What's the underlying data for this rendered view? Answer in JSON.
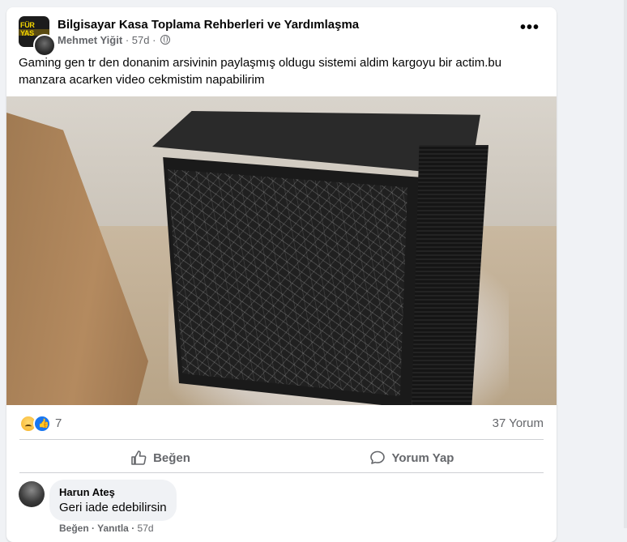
{
  "group": {
    "name": "Bilgisayar Kasa Toplama Rehberleri ve Yardımlaşma",
    "avatar_text": "FÜR YAS"
  },
  "post": {
    "author": "Mehmet Yiğit",
    "separator": "·",
    "time": "57d",
    "privacy_icon": "globe-icon",
    "more_icon": "•••",
    "text": "Gaming gen tr den donanim arsivinin paylaşmış oldugu sistemi aldim kargoyu bir actim.bu manzara acarken video cekmistim napabilirim"
  },
  "reactions": {
    "icons": [
      "angry-face-icon",
      "like-thumb-icon"
    ],
    "count": "7",
    "comments": "37 Yorum"
  },
  "actions": {
    "like": "Beğen",
    "comment": "Yorum Yap"
  },
  "comment": {
    "author": "Harun Ateş",
    "text": "Geri iade edebilirsin",
    "like": "Beğen",
    "reply": "Yanıtla",
    "separator": "·",
    "time": "57d"
  },
  "colors": {
    "page_bg": "#f0f2f5",
    "card_bg": "#ffffff",
    "secondary_text": "#65676b",
    "like_blue": "#1877f2"
  }
}
